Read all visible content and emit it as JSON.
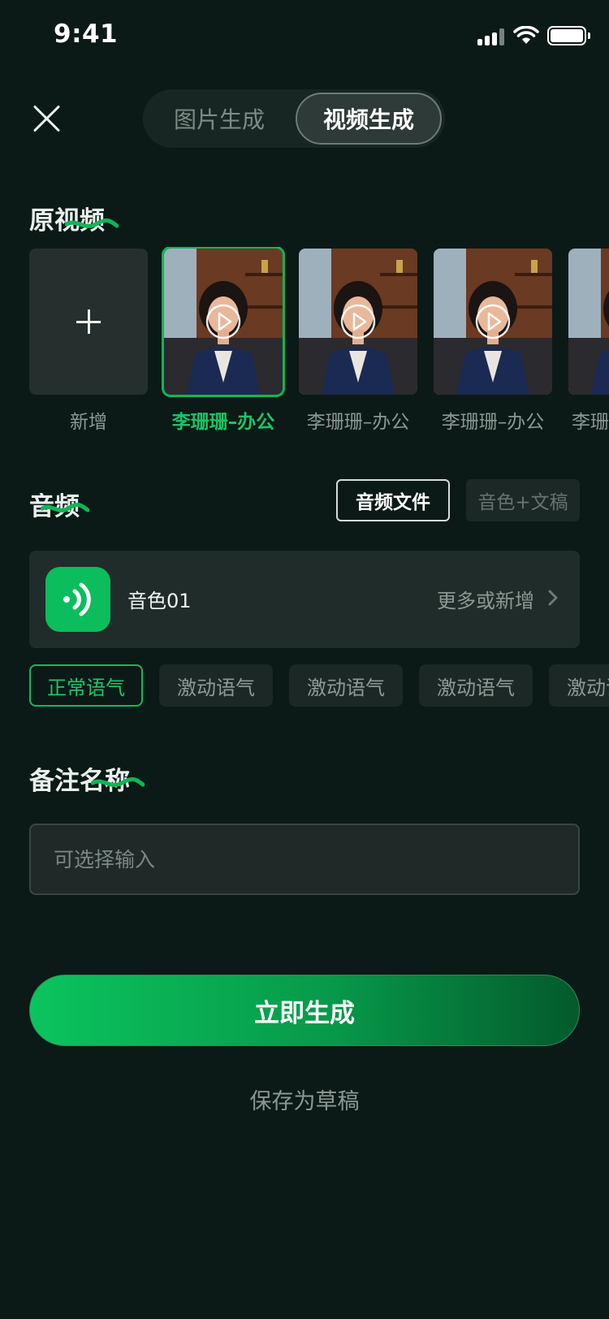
{
  "status_bar": {
    "time": "9:41"
  },
  "header": {
    "tabs": [
      {
        "label": "图片生成",
        "active": false
      },
      {
        "label": "视频生成",
        "active": true
      }
    ]
  },
  "original_video": {
    "title": "原视频",
    "add_label": "新增",
    "items": [
      {
        "label": "李珊珊–办公",
        "selected": true
      },
      {
        "label": "李珊珊–办公",
        "selected": false
      },
      {
        "label": "李珊珊–办公",
        "selected": false
      },
      {
        "label": "李珊珊–办公",
        "selected": false
      }
    ]
  },
  "audio": {
    "title": "音频",
    "toggle_file": "音频文件",
    "toggle_tts": "音色+文稿",
    "voice_name": "音色01",
    "voice_more": "更多或新增",
    "tones": [
      "正常语气",
      "激动语气",
      "激动语气",
      "激动语气",
      "激动语气"
    ]
  },
  "note": {
    "title": "备注名称",
    "placeholder": "可选择输入"
  },
  "actions": {
    "generate": "立即生成",
    "save_draft": "保存为草稿"
  },
  "colors": {
    "background": "#0b1a17",
    "accent": "#10b555"
  }
}
